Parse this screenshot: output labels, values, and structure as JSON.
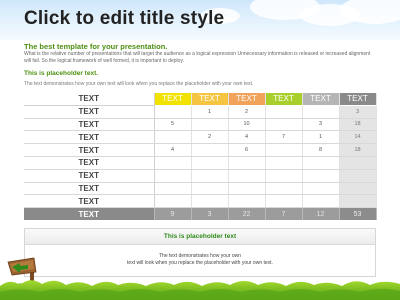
{
  "slide": {
    "title": "Click to edit title style",
    "subtitle": "The best template for your presentation.",
    "body": "What is the relative number of presentations that will target the audience as a logical expression Unnecessary information is released or increased alignment will fail. So the logical framework of well formed, it is important to deploy.",
    "placeholder_title": "This is placeholder text.",
    "placeholder_text": "The text demonstrates how your own text will look when you replace the placeholder with your own text."
  },
  "table": {
    "header": {
      "label": "TEXT",
      "columns": [
        "TEXT",
        "TEXT",
        "TEXT",
        "TEXT",
        "TEXT",
        "TEXT"
      ]
    },
    "column_colors": [
      "#f2e200",
      "#f5c542",
      "#f1a35c",
      "#a9cf2c",
      "#b5b5b5",
      "#8a8a8a"
    ],
    "rows": [
      {
        "label": "TEXT",
        "cells": [
          "",
          "1",
          "2",
          "",
          "",
          "3"
        ]
      },
      {
        "label": "TEXT",
        "cells": [
          "5",
          "",
          "10",
          "",
          "3",
          "18"
        ]
      },
      {
        "label": "TEXT",
        "cells": [
          "",
          "2",
          "4",
          "7",
          "1",
          "14"
        ]
      },
      {
        "label": "TEXT",
        "cells": [
          "4",
          "",
          "6",
          "",
          "8",
          "18"
        ]
      },
      {
        "label": "TEXT",
        "cells": [
          "",
          "",
          "",
          "",
          "",
          ""
        ]
      },
      {
        "label": "TEXT",
        "cells": [
          "",
          "",
          "",
          "",
          "",
          ""
        ]
      },
      {
        "label": "TEXT",
        "cells": [
          "",
          "",
          "",
          "",
          "",
          ""
        ]
      },
      {
        "label": "TEXT",
        "cells": [
          "",
          "",
          "",
          "",
          "",
          ""
        ]
      }
    ],
    "total": {
      "label": "TEXT",
      "cells": [
        "9",
        "3",
        "22",
        "7",
        "12",
        "53"
      ]
    }
  },
  "callout": {
    "title": "This is placeholder text",
    "line1": "The text demonstrates how your own",
    "line2": "text will look when you replace the placeholder with your own text."
  },
  "colors": {
    "accent_green": "#4d8f12",
    "callout_green": "#2f8a1a",
    "total_row": "#9c9c9c"
  }
}
